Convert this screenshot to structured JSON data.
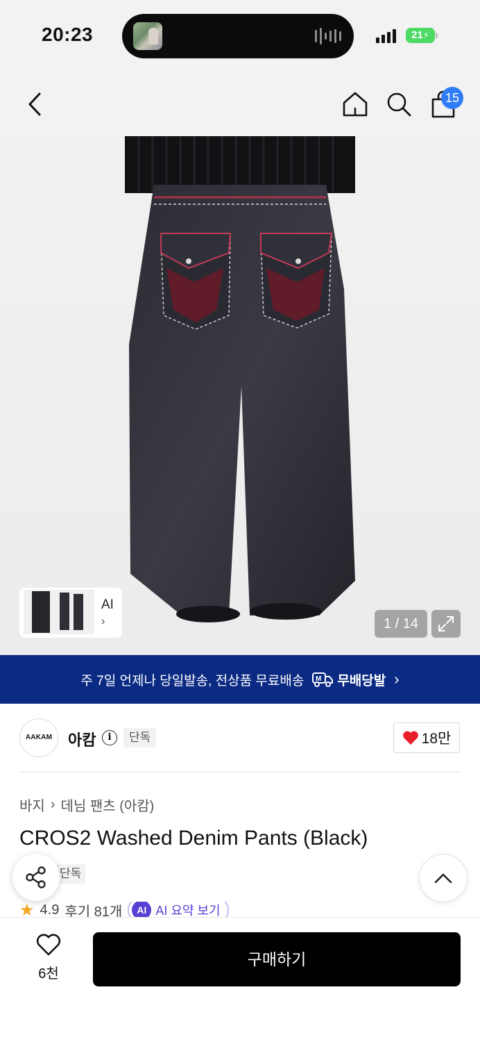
{
  "status_bar": {
    "time": "20:23",
    "battery": "21"
  },
  "header": {
    "cart_count": "15"
  },
  "gallery": {
    "thumb_label": "AI",
    "thumb_chevron": "›",
    "counter": "1 / 14"
  },
  "banner": {
    "text": "주 7일 언제나 당일발송, 전상품 무료배송",
    "brand": "무배당발",
    "chevron": "›"
  },
  "brand": {
    "logo_text": "AAKAM",
    "name": "아캄",
    "info": "i",
    "badge": "단독",
    "likes": "18만"
  },
  "product": {
    "breadcrumb": [
      "바지",
      "데님 팬츠 (아캄)"
    ],
    "breadcrumb_sep": "›",
    "title": "CROS2 Washed Denim Pants (Black)",
    "badge": "단독",
    "rating": "4.9",
    "reviews": "후기 81개",
    "ai_icon": "AI",
    "ai_summary": "AI 요약 보기"
  },
  "bottom_bar": {
    "wish_count": "6천",
    "buy_label": "구매하기"
  },
  "colors": {
    "banner_bg": "#0b2a83",
    "badge_blue": "#2f7cf6",
    "heart_red": "#e8202c",
    "star": "#f5a623"
  },
  "icons": [
    "back-icon",
    "home-icon",
    "search-icon",
    "shopping-bag-icon",
    "expand-icon",
    "heart-icon",
    "share-icon",
    "chevron-up-icon",
    "truck-icon"
  ]
}
